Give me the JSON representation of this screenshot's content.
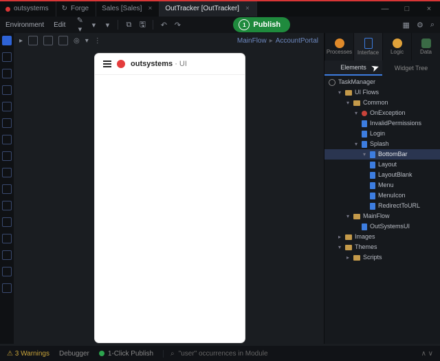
{
  "tabs": {
    "t0": "outsystems",
    "t1": "Forge",
    "t2": "Sales [Sales]",
    "t3": "OutTracker [OutTracker]"
  },
  "menu": {
    "env": "Environment",
    "edit": "Edit",
    "publish": "Publish",
    "one": "1"
  },
  "breadcrumb": {
    "a": "MainFlow",
    "b": "AccountPortal"
  },
  "preview": {
    "brand": "outsystems",
    "sub": " · UI"
  },
  "cats": {
    "processes": "Processes",
    "interface": "Interface",
    "logic": "Logic",
    "data": "Data"
  },
  "rtabs": {
    "elements": "Elements",
    "widget": "Widget Tree"
  },
  "tree": {
    "task": "TaskManager",
    "uiflows": "UI Flows",
    "common": "Common",
    "onexc": "OnException",
    "invperm": "InvalidPermissions",
    "login": "Login",
    "splash": "Splash",
    "bottombar": "BottomBar",
    "layout": "Layout",
    "layoutblank": "LayoutBlank",
    "menu": "Menu",
    "menuicon": "MenuIcon",
    "redirect": "RedirectToURL",
    "mainflow": "MainFlow",
    "ossysui": "OutSystemsUI",
    "images": "Images",
    "themes": "Themes",
    "scripts": "Scripts"
  },
  "status": {
    "warnings": "3 Warnings",
    "debugger": "Debugger",
    "publish": "1-Click Publish",
    "search": "\"user\" occurrences in Module"
  }
}
